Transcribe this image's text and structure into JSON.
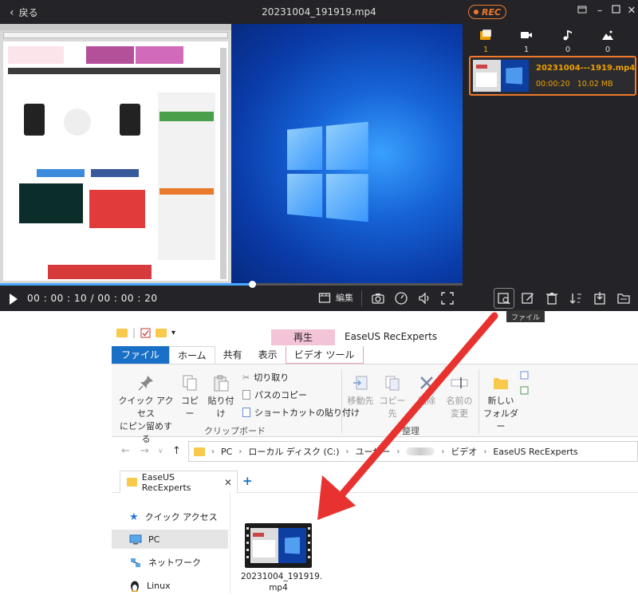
{
  "player": {
    "back_label": "戻る",
    "title": "20231004_191919.mp4",
    "rec_label": "REC",
    "timecode": "00 : 00 : 10 / 00 : 00 : 20",
    "progress_fraction": 0.545,
    "edit_label": "編集",
    "tooltip": "ファイル"
  },
  "media_panel": {
    "tabs": [
      {
        "icon": "folder-image-icon",
        "count": "1"
      },
      {
        "icon": "video-camera-icon",
        "count": "1"
      },
      {
        "icon": "music-note-icon",
        "count": "0"
      },
      {
        "icon": "image-icon",
        "count": "0"
      }
    ],
    "recording": {
      "name": "20231004---1919.mp4",
      "duration": "00:00:20",
      "size": "10.02 MB"
    }
  },
  "explorer": {
    "context_tab_header": "再生",
    "window_title": "EaseUS RecExperts",
    "ribbon_tabs": [
      "ファイル",
      "ホーム",
      "共有",
      "表示",
      "ビデオ ツール"
    ],
    "ribbon": {
      "pin_label_1": "クイック アクセス",
      "pin_label_2": "にピン留めする",
      "copy": "コピー",
      "paste": "貼り付け",
      "cut": "切り取り",
      "copy_path": "パスのコピー",
      "paste_shortcut": "ショートカットの貼り付け",
      "clipboard_group": "クリップボード",
      "move_to": "移動先",
      "copy_to": "コピー先",
      "delete": "削除",
      "rename_1": "名前の",
      "rename_2": "変更",
      "organize_group": "整理",
      "new_folder_1": "新しい",
      "new_folder_2": "フォルダー"
    },
    "address": [
      "PC",
      "ローカル ディスク (C:)",
      "ユーザー",
      "ビデオ",
      "EaseUS RecExperts"
    ],
    "tab_label": "EaseUS RecExperts",
    "nav": [
      "クイック アクセス",
      "PC",
      "ネットワーク",
      "Linux"
    ],
    "file_name_1": "20231004_191919.",
    "file_name_2": "mp4"
  }
}
